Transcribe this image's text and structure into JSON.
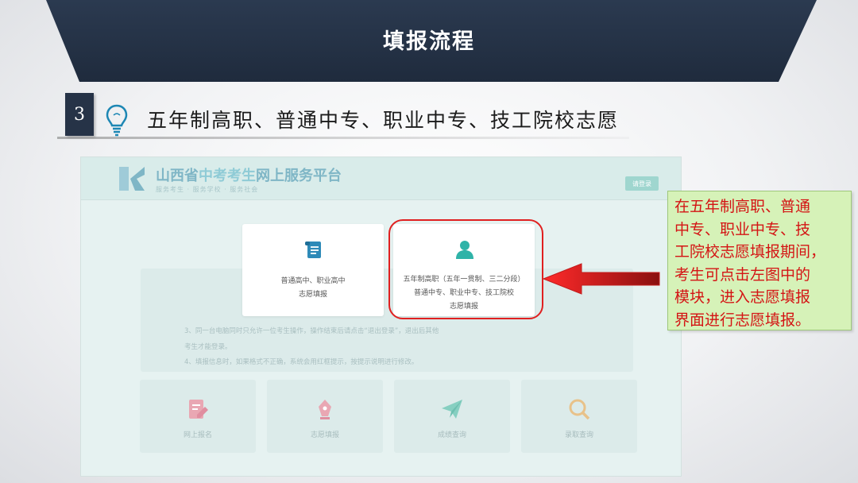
{
  "banner": {
    "title": "填报流程"
  },
  "step": {
    "number": "3",
    "title": "五年制高职、普通中专、职业中专、技工院校志愿"
  },
  "site": {
    "title_part1": "山西省",
    "title_part2": "中考考生",
    "title_part3": "网上服务平台",
    "subtitle": "服务考生 · 服务学校 · 服务社会",
    "login_label": "请登录"
  },
  "popup_cards": [
    {
      "line1": "普通高中、职业高中",
      "line2": "志愿填报",
      "line3": ""
    },
    {
      "line1": "五年制高职（五年一贯制、三二分段）",
      "line2": "普通中专、职业中专、技工院校",
      "line3": "志愿填报"
    }
  ],
  "notice_lines": [
    "3、同一台电脑同时只允许一位考生操作，操作结束后请点击“退出登录”，退出后其他",
    "考生才能登录。",
    "4、填报信息时，如果格式不正确，系统会用红框提示，按提示说明进行修改。"
  ],
  "bottom_cards": [
    {
      "label": "网上报名",
      "icon": "edit-icon"
    },
    {
      "label": "志愿填报",
      "icon": "pen-icon"
    },
    {
      "label": "成绩查询",
      "icon": "paper-plane-icon"
    },
    {
      "label": "录取查询",
      "icon": "magnifier-icon"
    }
  ],
  "callout": {
    "lines": [
      "在五年制高职、普通",
      "中专、职业中专、技",
      "工院校志愿填报期间，",
      "考生可点击左图中的",
      "模块，进入志愿填报",
      "界面进行志愿填报。"
    ]
  },
  "colors": {
    "banner": "#263347",
    "accent_teal": "#2fb3a8",
    "highlight_red": "#e02020",
    "callout_bg": "#d6f2b8",
    "callout_text": "#d41414"
  }
}
